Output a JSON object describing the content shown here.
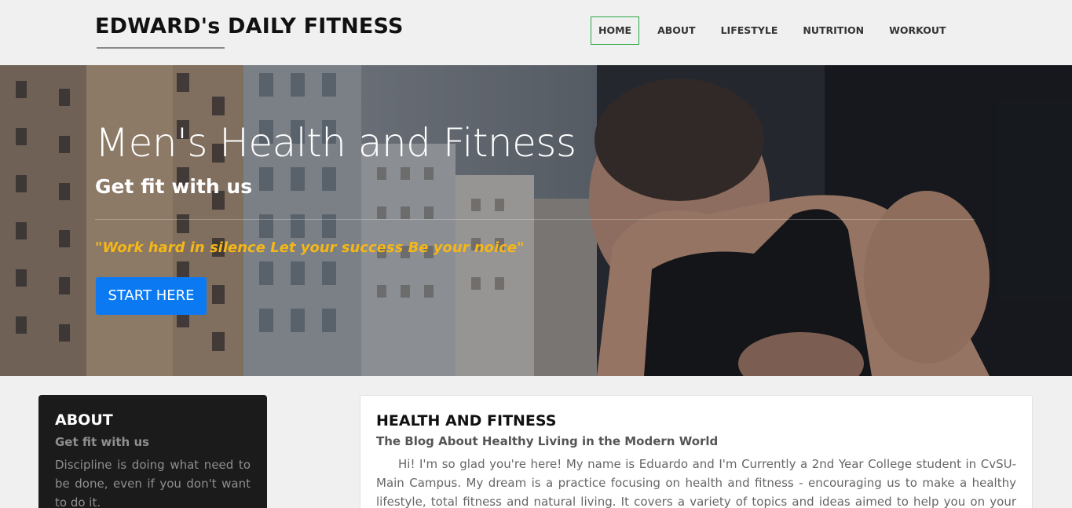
{
  "header": {
    "brand": "EDWARD's DAILY FITNESS",
    "nav": [
      {
        "label": "HOME",
        "active": true
      },
      {
        "label": "ABOUT",
        "active": false
      },
      {
        "label": "LIFESTYLE",
        "active": false
      },
      {
        "label": "NUTRITION",
        "active": false
      },
      {
        "label": "WORKOUT",
        "active": false
      }
    ]
  },
  "hero": {
    "title": "Men's Health and Fitness",
    "subtitle": "Get fit with us",
    "quote": "\"Work hard in silence Let your success Be your noice\"",
    "cta": "START HERE",
    "image": "man-working-out-photo"
  },
  "about": {
    "title": "ABOUT",
    "subtitle": "Get fit with us",
    "text": "Discipline is doing what need to be done, even if you don't want to do it."
  },
  "blog": {
    "title": "HEALTH AND FITNESS",
    "subtitle": "The Blog About Healthy Living in the Modern World",
    "text": "Hi! I'm so glad you're here! My name is Eduardo and I'm Currently a 2nd Year College student in CvSU-Main Campus. My dream is a practice focusing on health and fitness - encouraging us to make a healthy lifestyle, total fitness and natural living. It covers a variety of topics and ideas aimed to help you on your fitness journey. It"
  },
  "colors": {
    "accent": "#0b7af2",
    "quote": "#f5b718",
    "nav_active_border": "#28a745"
  }
}
